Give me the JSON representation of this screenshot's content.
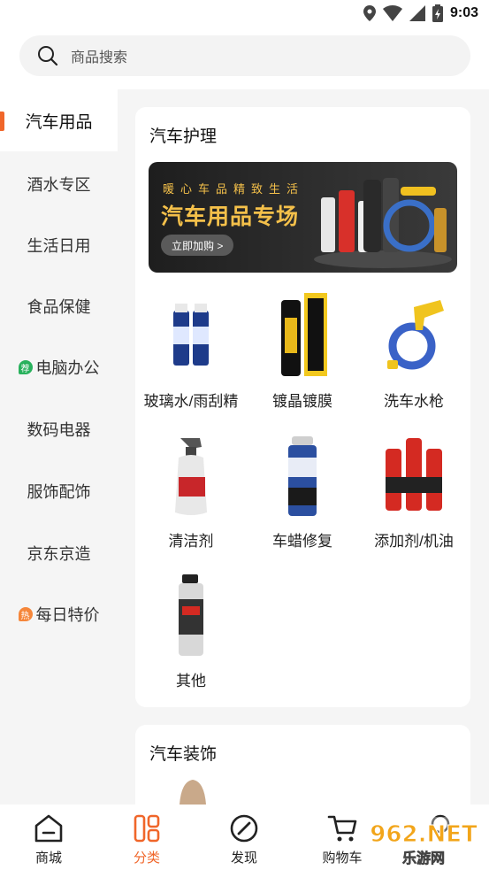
{
  "status_bar": {
    "time": "9:03",
    "icons": [
      "location-icon",
      "wifi-icon",
      "signal-icon",
      "battery-icon"
    ]
  },
  "search": {
    "placeholder": "商品搜索"
  },
  "sidebar": {
    "items": [
      {
        "label": "汽车用品",
        "active": true
      },
      {
        "label": "酒水专区"
      },
      {
        "label": "生活日用"
      },
      {
        "label": "食品保健"
      },
      {
        "label": "电脑办公",
        "badge": "荐"
      },
      {
        "label": "数码电器"
      },
      {
        "label": "服饰配饰"
      },
      {
        "label": "京东京造"
      },
      {
        "label": "每日特价",
        "badge": "热"
      }
    ]
  },
  "sections": [
    {
      "title": "汽车护理",
      "banner": {
        "subtitle": "暖心车品精致生活",
        "headline": "汽车用品专场",
        "button": "立即加购 >"
      },
      "items": [
        {
          "label": "玻璃水/雨刮精"
        },
        {
          "label": "镀晶镀膜"
        },
        {
          "label": "洗车水枪"
        },
        {
          "label": "清洁剂"
        },
        {
          "label": "车蜡修复"
        },
        {
          "label": "添加剂/机油"
        },
        {
          "label": "其他"
        }
      ]
    },
    {
      "title": "汽车装饰"
    }
  ],
  "bottom_nav": [
    {
      "label": "商城",
      "icon": "home-icon"
    },
    {
      "label": "分类",
      "icon": "category-icon",
      "active": true
    },
    {
      "label": "发现",
      "icon": "compass-icon"
    },
    {
      "label": "购物车",
      "icon": "cart-icon"
    },
    {
      "label": "",
      "icon": "profile-icon"
    }
  ],
  "watermark": {
    "text": "962.NET",
    "subtext": "乐游网"
  },
  "colors": {
    "accent": "#f0662a",
    "sidebar_bg": "#f5f5f5",
    "banner_text": "#f4c04a"
  }
}
